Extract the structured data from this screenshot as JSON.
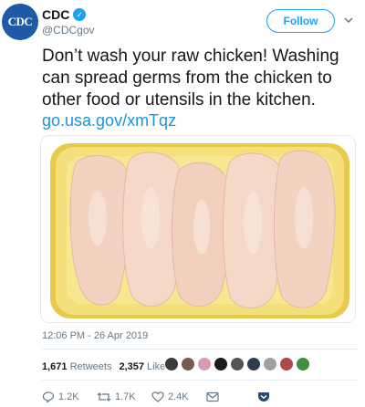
{
  "account": {
    "avatar_text": "CDC",
    "display_name": "CDC",
    "handle": "@CDCgov",
    "verified_icon": "verified-badge-icon"
  },
  "header": {
    "follow_label": "Follow",
    "menu_icon": "chevron-down-icon"
  },
  "tweet": {
    "text": "Don’t wash your raw chicken! Washing can spread germs from the chicken to other food or utensils in the kitchen.",
    "link": "go.usa.gov/xmTqz",
    "timestamp": "12:06 PM - 26 Apr 2019"
  },
  "stats": {
    "retweets_count": "1,671",
    "retweets_label": "Retweets",
    "likes_count": "2,357",
    "likes_label": "Likes"
  },
  "actions": {
    "reply_count": "1.2K",
    "retweet_count": "1.7K",
    "like_count": "2.4K"
  },
  "colors": {
    "accent": "#1da1f2",
    "link": "#1b95e0",
    "muted": "#657786",
    "tray": "#f3e07a",
    "chicken": "#f3d7c6"
  }
}
